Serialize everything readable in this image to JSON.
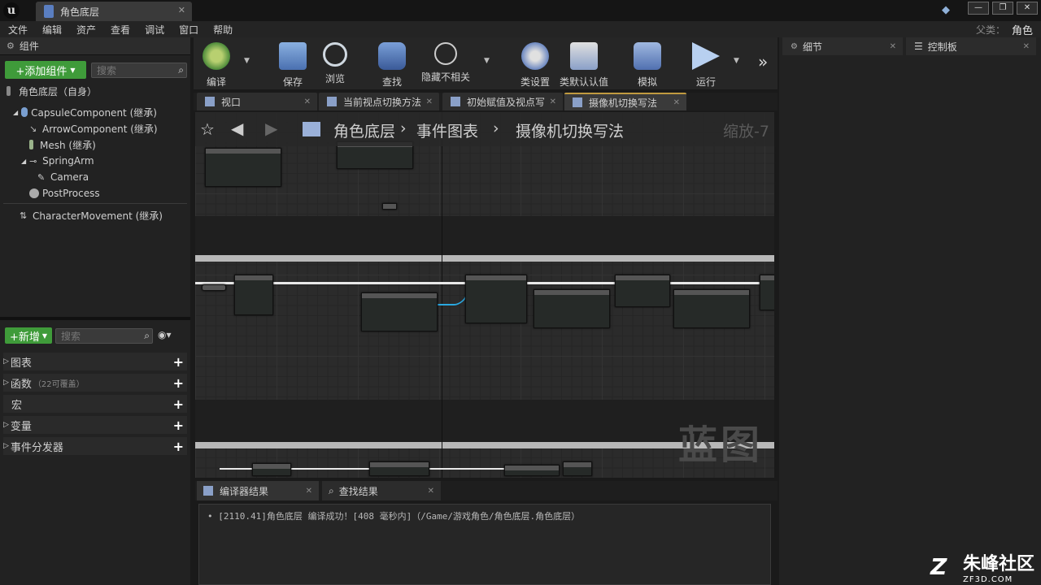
{
  "window": {
    "tab_title": "角色底层",
    "tab_close": "✕",
    "controls": [
      "—",
      "❐",
      "✕"
    ]
  },
  "menu": [
    "文件",
    "编辑",
    "资产",
    "查看",
    "调试",
    "窗口",
    "帮助"
  ],
  "parent_class": {
    "label": "父类：",
    "value": "角色"
  },
  "components_panel": {
    "title": "组件",
    "add_button": "+添加组件",
    "search_placeholder": "搜索",
    "root": "角色底层（自身）",
    "tree": [
      {
        "label": "CapsuleComponent (继承)",
        "icon": "capsule-icon"
      },
      {
        "label": "ArrowComponent (继承)",
        "icon": "arrow-icon"
      },
      {
        "label": "Mesh (继承)",
        "icon": "mesh-icon"
      },
      {
        "label": "SpringArm",
        "icon": "spring-arm-icon"
      },
      {
        "label": "Camera",
        "icon": "camera-icon"
      },
      {
        "label": "PostProcess",
        "icon": "post-process-icon"
      },
      {
        "label": "CharacterMovement (继承)",
        "icon": "movement-icon"
      }
    ]
  },
  "my_blueprint": {
    "add_button": "+新增",
    "search_placeholder": "搜索",
    "sections": [
      {
        "label": "图表"
      },
      {
        "label": "函数",
        "note": "（22可覆盖）"
      },
      {
        "label": "宏"
      },
      {
        "label": "变量"
      },
      {
        "label": "事件分发器"
      }
    ]
  },
  "toolbar": {
    "compile": "编译",
    "save": "保存",
    "browse": "浏览",
    "find": "查找",
    "hide_unrelated": "隐藏不相关",
    "class_settings": "类设置",
    "class_defaults": "类默认认值",
    "simulate": "模拟",
    "play": "运行",
    "more": "»"
  },
  "graph_tabs": [
    {
      "label": "视口",
      "active": false
    },
    {
      "label": "当前视点切换方法",
      "active": false
    },
    {
      "label": "初始赋值及视点写",
      "active": false
    },
    {
      "label": "摄像机切换写法",
      "active": true
    }
  ],
  "graph": {
    "breadcrumb": [
      "角色底层",
      "事件图表",
      "摄像机切换写法"
    ],
    "zoom": "缩放-7",
    "watermark": "蓝图"
  },
  "bottom_tabs": [
    "编译器结果",
    "查找结果"
  ],
  "log": "•  [2110.41]角色底层 编译成功！[408 毫秒内]（/Game/游戏角色/角色底层.角色底层）",
  "right_tabs": [
    "细节",
    "控制板"
  ],
  "brand": {
    "name": "朱峰社区",
    "url": "ZF3D.COM",
    "logo": "Z"
  },
  "colors": {
    "accent_green": "#3f9b3a",
    "active_tab": "#c09a40",
    "wire": "#2aa8e0"
  }
}
